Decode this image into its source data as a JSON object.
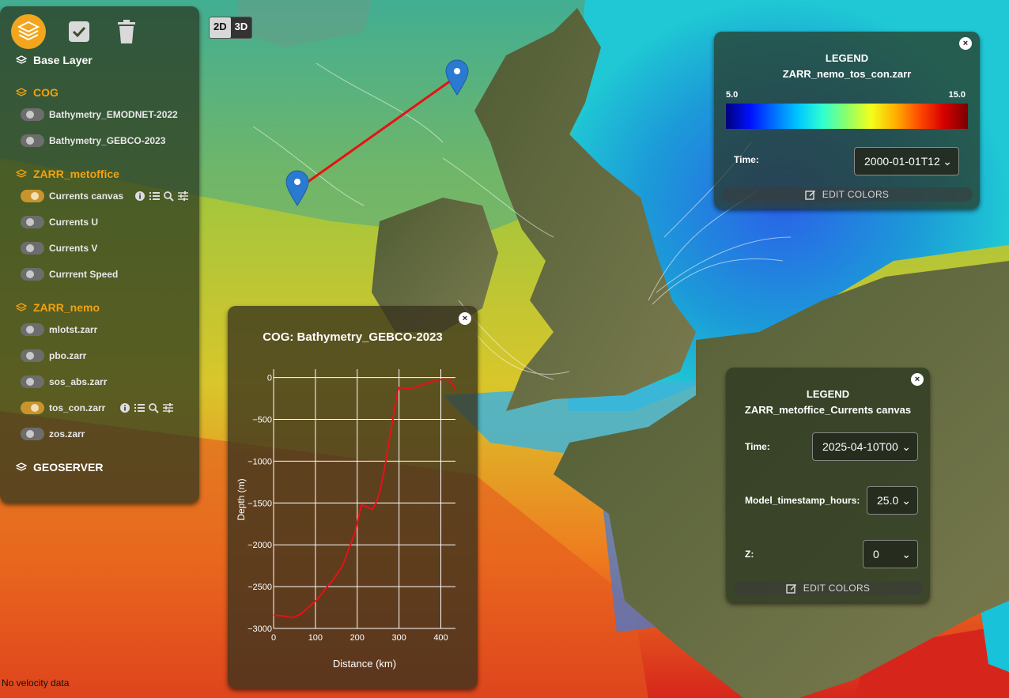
{
  "layer_panel": {
    "buttons": {
      "layers_icon": "layers-icon",
      "check_icon": "check-icon",
      "trash_icon": "trash-icon"
    },
    "base_layer_label": "Base Layer",
    "groups": [
      {
        "name": "COG",
        "layers": [
          {
            "label": "Bathymetry_EMODNET-2022",
            "enabled": false
          },
          {
            "label": "Bathymetry_GEBCO-2023",
            "enabled": false
          }
        ]
      },
      {
        "name": "ZARR_metoffice",
        "layers": [
          {
            "label": "Currents canvas",
            "enabled": true
          },
          {
            "label": "Currents U",
            "enabled": false
          },
          {
            "label": "Currents V",
            "enabled": false
          },
          {
            "label": "Currrent Speed",
            "enabled": false
          }
        ]
      },
      {
        "name": "ZARR_nemo",
        "layers": [
          {
            "label": "mlotst.zarr",
            "enabled": false
          },
          {
            "label": "pbo.zarr",
            "enabled": false
          },
          {
            "label": "sos_abs.zarr",
            "enabled": false
          },
          {
            "label": "tos_con.zarr",
            "enabled": true
          },
          {
            "label": "zos.zarr",
            "enabled": false
          }
        ]
      }
    ],
    "geoserver_label": "GEOSERVER"
  },
  "view_toggle": {
    "btn_2d": "2D",
    "btn_3d": "3D",
    "active": "2D"
  },
  "legend_tos": {
    "heading": "LEGEND",
    "layer": "ZARR_nemo_tos_con.zarr",
    "min": "5.0",
    "max": "15.0",
    "time_label": "Time:",
    "time_value": "2000-01-01T12",
    "edit_colors": "EDIT COLORS"
  },
  "legend_currents": {
    "heading": "LEGEND",
    "layer": "ZARR_metoffice_Currents canvas",
    "time_label": "Time:",
    "time_value": "2025-04-10T00",
    "model_label": "Model_timestamp_hours:",
    "model_value": "25.0",
    "z_label": "Z:",
    "z_value": "0",
    "edit_colors": "EDIT COLORS"
  },
  "status_text": "No velocity data",
  "chart_data": {
    "type": "line",
    "title": "COG: Bathymetry_GEBCO-2023",
    "xlabel": "Distance (km)",
    "ylabel": "Depth (m)",
    "xlim": [
      0,
      435
    ],
    "ylim": [
      -3000,
      100
    ],
    "x_ticks": [
      0,
      100,
      200,
      300,
      400
    ],
    "y_ticks": [
      0,
      -500,
      -1000,
      -1500,
      -2000,
      -2500,
      -3000
    ],
    "x_tick_labels": [
      "0",
      "100",
      "200",
      "300",
      "400"
    ],
    "y_tick_labels": [
      "0",
      "−500",
      "−1000",
      "−1500",
      "−2000",
      "−2500",
      "−3000"
    ],
    "grid": true,
    "line_color": "#e8101a",
    "x": [
      0,
      20,
      45,
      65,
      85,
      105,
      125,
      145,
      165,
      180,
      195,
      210,
      225,
      235,
      245,
      255,
      265,
      275,
      285,
      295,
      300,
      310,
      330,
      360,
      390,
      410,
      420,
      430,
      435
    ],
    "y": [
      -2840,
      -2850,
      -2870,
      -2830,
      -2740,
      -2650,
      -2520,
      -2400,
      -2250,
      -2050,
      -1850,
      -1520,
      -1550,
      -1580,
      -1500,
      -1350,
      -1100,
      -800,
      -500,
      -200,
      -120,
      -125,
      -130,
      -80,
      -30,
      -20,
      -30,
      -100,
      -140
    ]
  }
}
